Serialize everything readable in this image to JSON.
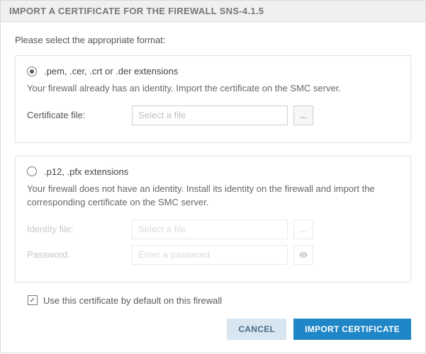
{
  "title": "IMPORT A CERTIFICATE FOR THE FIREWALL SNS-4.1.5",
  "prompt": "Please select the appropriate format:",
  "option1": {
    "label": ".pem, .cer, .crt or .der extensions",
    "desc": "Your firewall already has an identity. Import the certificate on the SMC server.",
    "cert_label": "Certificate file:",
    "cert_placeholder": "Select a file",
    "browse_label": "..."
  },
  "option2": {
    "label": ".p12, .pfx extensions",
    "desc": "Your firewall does not have an identity. Install its identity on the firewall and import the corresponding certificate on the SMC server.",
    "identity_label": "Identity file:",
    "identity_placeholder": "Select a file",
    "password_label": "Password:",
    "password_placeholder": "Enter a password",
    "browse_label": "..."
  },
  "default_checkbox": {
    "label": "Use this certificate by default on this firewall",
    "checked": true
  },
  "buttons": {
    "cancel": "CANCEL",
    "import": "IMPORT CERTIFICATE"
  },
  "selected_option": 1
}
